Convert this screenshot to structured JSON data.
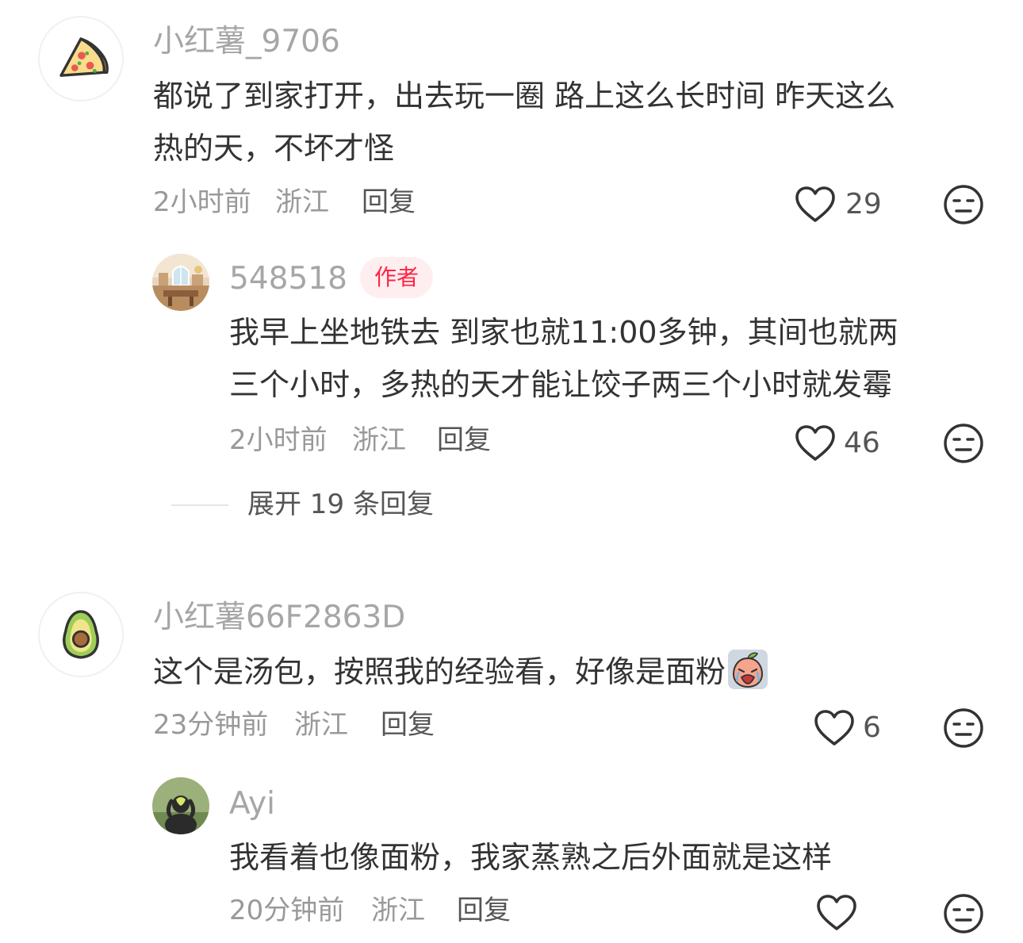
{
  "comments": [
    {
      "username": "小红薯_9706",
      "avatar_icon": "pizza-slice",
      "text_lines": [
        "都说了到家打开，出去玩一圈 路上这么长时间 昨天这么",
        "热的天，不坏才怪"
      ],
      "time": "2小时前",
      "location": "浙江",
      "reply_label": "回复",
      "likes": "29",
      "replies": [
        {
          "username": "548518",
          "badge": "作者",
          "avatar_icon": "room-photo",
          "text_lines": [
            "我早上坐地铁去 到家也就11:00多钟，其间也就两",
            "三个小时，多热的天才能让饺子两三个小时就发霉"
          ],
          "time": "2小时前",
          "location": "浙江",
          "reply_label": "回复",
          "likes": "46"
        }
      ],
      "expand_label": "展开 19 条回复"
    },
    {
      "username": "小红薯66F2863D",
      "avatar_icon": "avocado",
      "text_lines": [
        "这个是汤包，按照我的经验看，好像是面粉"
      ],
      "sticker": "crying-peach-sticker",
      "time": "23分钟前",
      "location": "浙江",
      "reply_label": "回复",
      "likes": "6",
      "replies": [
        {
          "username": "Ayi",
          "avatar_icon": "person-photo",
          "text_lines": [
            "我看着也像面粉，我家蒸熟之后外面就是这样"
          ],
          "time": "20分钟前",
          "location": "浙江",
          "reply_label": "回复",
          "likes": ""
        }
      ]
    }
  ],
  "colors": {
    "username": "#a6a6a6",
    "text": "#333333",
    "meta": "#999999",
    "badge_text": "#ff2442",
    "badge_bg": "#ffeef0"
  }
}
